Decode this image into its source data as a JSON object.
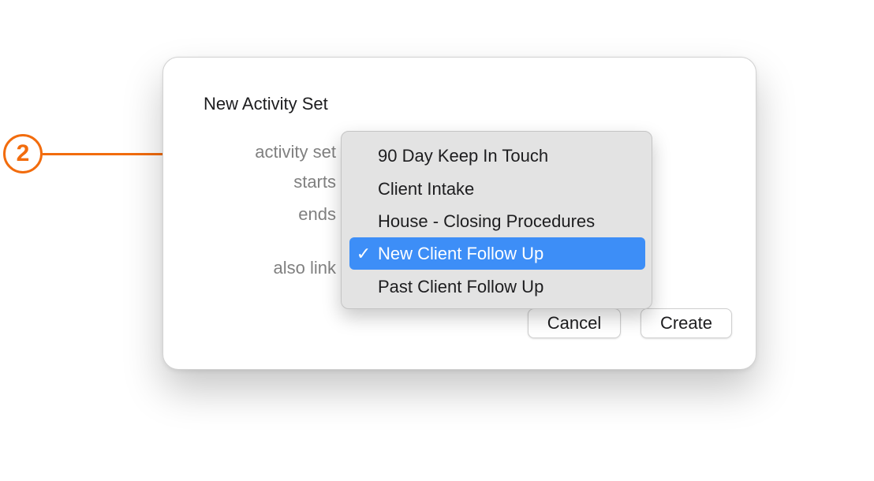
{
  "callout": {
    "number": "2",
    "color": "#f26c0d"
  },
  "dialog": {
    "title": "New Activity Set",
    "fields": {
      "activity_set_label": "activity set",
      "starts_label": "starts",
      "ends_label": "ends",
      "also_link_label": "also link"
    },
    "buttons": {
      "cancel_label": "Cancel",
      "create_label": "Create"
    }
  },
  "activity_set_menu": {
    "selected_index": 3,
    "selected_color": "#3d8ef7",
    "check_glyph": "✓",
    "items": [
      {
        "label": "90 Day Keep In Touch",
        "check": ""
      },
      {
        "label": "Client Intake",
        "check": ""
      },
      {
        "label": "House - Closing Procedures",
        "check": ""
      },
      {
        "label": "New Client Follow Up",
        "check": "✓"
      },
      {
        "label": "Past Client Follow Up",
        "check": ""
      }
    ]
  }
}
